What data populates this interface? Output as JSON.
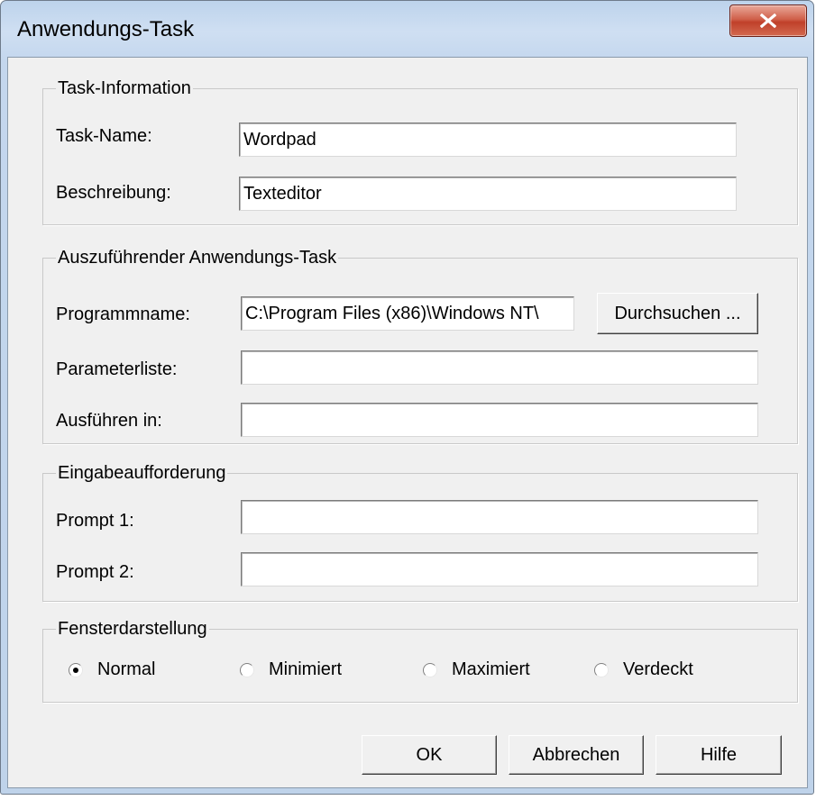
{
  "window": {
    "title": "Anwendungs-Task",
    "close_label": "X"
  },
  "task_info": {
    "legend": "Task-Information",
    "name_label": "Task-Name:",
    "name_value": "Wordpad",
    "desc_label": "Beschreibung:",
    "desc_value": "Texteditor"
  },
  "app_task": {
    "legend": "Auszuführender Anwendungs-Task",
    "program_label": "Programmname:",
    "program_value": "C:\\Program Files (x86)\\Windows NT\\",
    "browse_label": "Durchsuchen ...",
    "params_label": "Parameterliste:",
    "params_value": "",
    "run_in_label": "Ausführen in:",
    "run_in_value": ""
  },
  "prompt": {
    "legend": "Eingabeaufforderung",
    "prompt1_label": "Prompt 1:",
    "prompt1_value": "",
    "prompt2_label": "Prompt 2:",
    "prompt2_value": ""
  },
  "window_display": {
    "legend": "Fensterdarstellung",
    "options": [
      "Normal",
      "Minimiert",
      "Maximiert",
      "Verdeckt"
    ],
    "selected": "Normal"
  },
  "buttons": {
    "ok": "OK",
    "cancel": "Abbrechen",
    "help": "Hilfe"
  }
}
